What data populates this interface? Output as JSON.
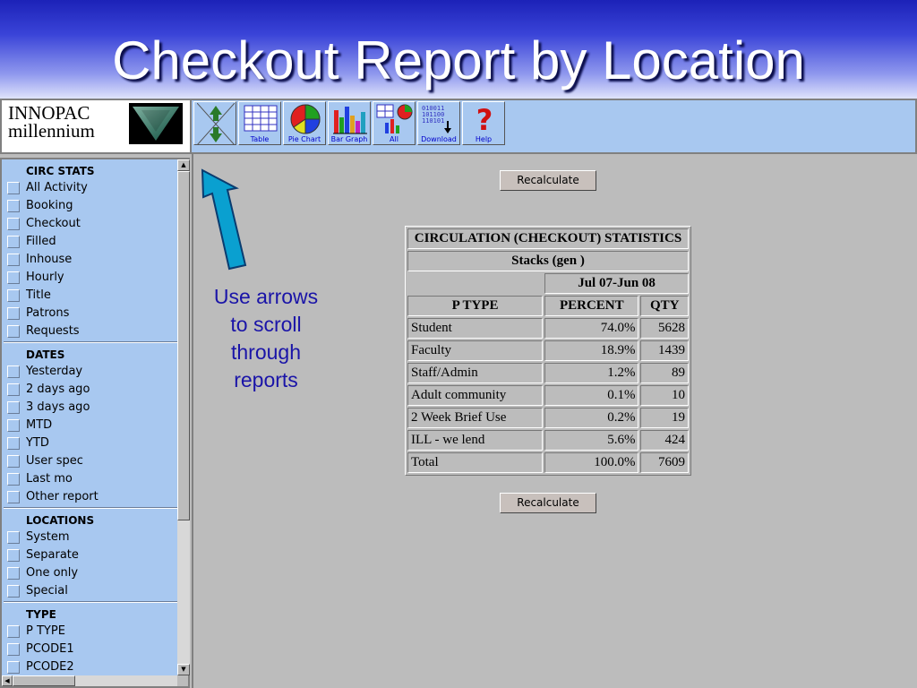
{
  "slide": {
    "title": "Checkout Report by Location"
  },
  "logo": {
    "line1": "INNOPAC",
    "line2": "millennium"
  },
  "toolbar": {
    "buttons": [
      {
        "label": "",
        "icon": "scroll-arrows-icon"
      },
      {
        "label": "Table",
        "icon": "table-icon"
      },
      {
        "label": "Pie Chart",
        "icon": "pie-chart-icon"
      },
      {
        "label": "Bar Graph",
        "icon": "bar-graph-icon"
      },
      {
        "label": "All",
        "icon": "all-views-icon"
      },
      {
        "label": "Download",
        "icon": "download-icon"
      },
      {
        "label": "Help",
        "icon": "help-icon"
      }
    ]
  },
  "sidebar": {
    "sections": [
      {
        "title": "CIRC STATS",
        "items": [
          "All Activity",
          "Booking",
          "Checkout",
          "Filled",
          "Inhouse",
          "Hourly",
          "Title",
          "Patrons",
          "Requests"
        ]
      },
      {
        "title": "DATES",
        "items": [
          "Yesterday",
          "2 days ago",
          "3 days ago",
          "MTD",
          "YTD",
          "User spec",
          "Last mo",
          "Other report"
        ]
      },
      {
        "title": "LOCATIONS",
        "items": [
          "System",
          "Separate",
          "One only",
          "Special"
        ]
      },
      {
        "title": "TYPE",
        "items": [
          "P TYPE",
          "PCODE1",
          "PCODE2"
        ]
      }
    ]
  },
  "report": {
    "recalculate_label": "Recalculate",
    "title": "CIRCULATION (CHECKOUT) STATISTICS",
    "location": "Stacks (gen )",
    "period": "Jul 07-Jun 08",
    "columns": [
      "P TYPE",
      "PERCENT",
      "QTY"
    ],
    "rows": [
      {
        "ptype": "Student",
        "percent": "74.0%",
        "qty": "5628"
      },
      {
        "ptype": "Faculty",
        "percent": "18.9%",
        "qty": "1439"
      },
      {
        "ptype": "Staff/Admin",
        "percent": "1.2%",
        "qty": "89"
      },
      {
        "ptype": "Adult community",
        "percent": "0.1%",
        "qty": "10"
      },
      {
        "ptype": "2 Week Brief Use",
        "percent": "0.2%",
        "qty": "19"
      },
      {
        "ptype": "ILL - we lend",
        "percent": "5.6%",
        "qty": "424"
      },
      {
        "ptype": "Total",
        "percent": "100.0%",
        "qty": "7609"
      }
    ]
  },
  "annotation": {
    "text": "Use arrows to scroll through reports",
    "arrow_color": "#0aa0d0",
    "text_color": "#1a14a8"
  }
}
